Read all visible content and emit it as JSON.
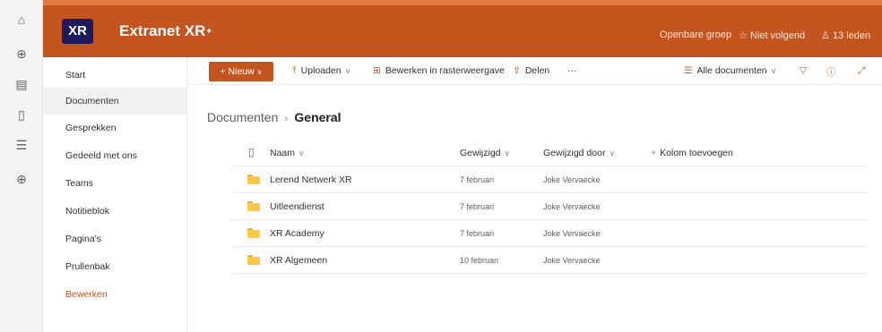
{
  "rail": {
    "icons": [
      "home-icon",
      "globe-icon",
      "news-icon",
      "document-icon",
      "list-icon",
      "add-icon"
    ]
  },
  "site": {
    "logo_text": "XR",
    "title": "Extranet XR",
    "group_type": "Openbare groep",
    "follow_label": "Niet volgend",
    "members_label": "13 leden",
    "brand_color": "#c4551f"
  },
  "nav": {
    "items": [
      "Start",
      "Documenten",
      "Gesprekken",
      "Gedeeld met ons",
      "Teams",
      "Notitieblok",
      "Pagina's",
      "Prullenbak",
      "Bewerken"
    ],
    "active": "Documenten"
  },
  "commandbar": {
    "new_label": "Nieuw",
    "upload_label": "Uploaden",
    "grid_edit_label": "Bewerken in rasterweergave",
    "share_label": "Delen",
    "more_label": "···",
    "view_label": "Alle documenten"
  },
  "breadcrumb": {
    "root": "Documenten",
    "current": "General"
  },
  "table": {
    "columns": {
      "name": "Naam",
      "modified": "Gewijzigd",
      "modified_by": "Gewijzigd door",
      "add_column": "Kolom toevoegen"
    },
    "rows": [
      {
        "name": "Lerend Netwerk XR",
        "modified": "7 februari",
        "modified_by": "Joke Vervaecke"
      },
      {
        "name": "Uitleendienst",
        "modified": "7 februari",
        "modified_by": "Joke Vervaecke"
      },
      {
        "name": "XR Academy",
        "modified": "7 februari",
        "modified_by": "Joke Vervaecke"
      },
      {
        "name": "XR Algemeen",
        "modified": "10 februari",
        "modified_by": "Joke Vervaecke"
      }
    ]
  }
}
